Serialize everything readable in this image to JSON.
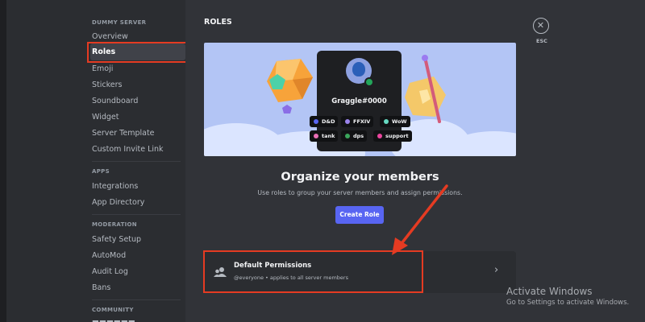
{
  "sidebar": {
    "categories": {
      "server": "DUMMY SERVER",
      "apps": "APPS",
      "moderation": "MODERATION",
      "community": "COMMUNITY"
    },
    "items": [
      "Overview",
      "Roles",
      "Emoji",
      "Stickers",
      "Soundboard",
      "Widget",
      "Server Template",
      "Custom Invite Link",
      "Integrations",
      "App Directory",
      "Safety Setup",
      "AutoMod",
      "Audit Log",
      "Bans"
    ],
    "active_item": "Roles"
  },
  "main": {
    "title": "ROLES",
    "close": {
      "icon": "close-icon",
      "label": "ESC"
    },
    "preview": {
      "username": "Graggle#0000",
      "roles": [
        {
          "name": "D&D",
          "color": "#5865f2"
        },
        {
          "name": "FFXIV",
          "color": "#9b84ec"
        },
        {
          "name": "WoW",
          "color": "#66d9c2"
        },
        {
          "name": "tank",
          "color": "#eb6fb6"
        },
        {
          "name": "dps",
          "color": "#3ba55c"
        },
        {
          "name": "support",
          "color": "#eb459e"
        }
      ]
    },
    "heading": "Organize your members",
    "subtext": "Use roles to group your server members and assign permissions.",
    "create_button": "Create Role",
    "default_permissions": {
      "title": "Default Permissions",
      "subtitle": "@everyone • applies to all server members"
    }
  },
  "watermark": {
    "title": "Activate Windows",
    "subtitle": "Go to Settings to activate Windows."
  },
  "colors": {
    "highlight": "#e53b22",
    "accent": "#5865f2",
    "background": "#313338",
    "sidebar": "#2b2d31"
  }
}
